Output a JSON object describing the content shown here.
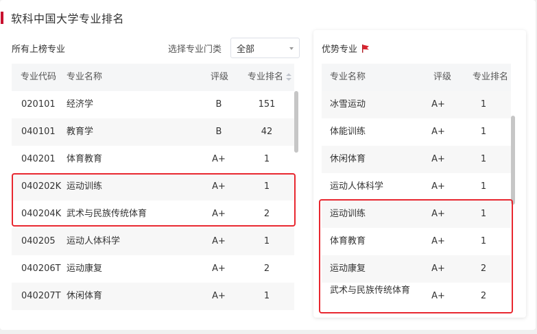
{
  "title": "软科中国大学专业排名",
  "left_panel": {
    "label": "所有上榜专业",
    "filter_label": "选择专业门类",
    "filter_value": "全部",
    "columns": [
      "专业代码",
      "专业名称",
      "评级",
      "专业排名"
    ],
    "rows": [
      {
        "code": "020101",
        "name": "经济学",
        "grade": "B",
        "rank": "151"
      },
      {
        "code": "040101",
        "name": "教育学",
        "grade": "B",
        "rank": "42"
      },
      {
        "code": "040201",
        "name": "体育教育",
        "grade": "A+",
        "rank": "1"
      },
      {
        "code": "040202K",
        "name": "运动训练",
        "grade": "A+",
        "rank": "1"
      },
      {
        "code": "040204K",
        "name": "武术与民族传统体育",
        "grade": "A+",
        "rank": "2"
      },
      {
        "code": "040205",
        "name": "运动人体科学",
        "grade": "A+",
        "rank": "1"
      },
      {
        "code": "040206T",
        "name": "运动康复",
        "grade": "A+",
        "rank": "2"
      },
      {
        "code": "040207T",
        "name": "休闲体育",
        "grade": "A+",
        "rank": "1"
      }
    ]
  },
  "right_panel": {
    "label": "优势专业",
    "columns": [
      "专业名称",
      "评级",
      "专业排名"
    ],
    "rows": [
      {
        "name": "冰雪运动",
        "grade": "A+",
        "rank": "1"
      },
      {
        "name": "体能训练",
        "grade": "A+",
        "rank": "1"
      },
      {
        "name": "休闲体育",
        "grade": "A+",
        "rank": "1"
      },
      {
        "name": "运动人体科学",
        "grade": "A+",
        "rank": "1"
      },
      {
        "name": "运动训练",
        "grade": "A+",
        "rank": "1"
      },
      {
        "name": "体育教育",
        "grade": "A+",
        "rank": "1"
      },
      {
        "name": "运动康复",
        "grade": "A+",
        "rank": "2"
      },
      {
        "name": "武术与民族传统体育",
        "grade": "A+",
        "rank": "2"
      }
    ]
  },
  "icons": {
    "flag": "flag-icon",
    "sort": "sort-icon",
    "caret": "chevron-down-icon"
  },
  "colors": {
    "accent": "#c8102e",
    "highlight": "#e8262e",
    "flag": "#d9232e"
  }
}
